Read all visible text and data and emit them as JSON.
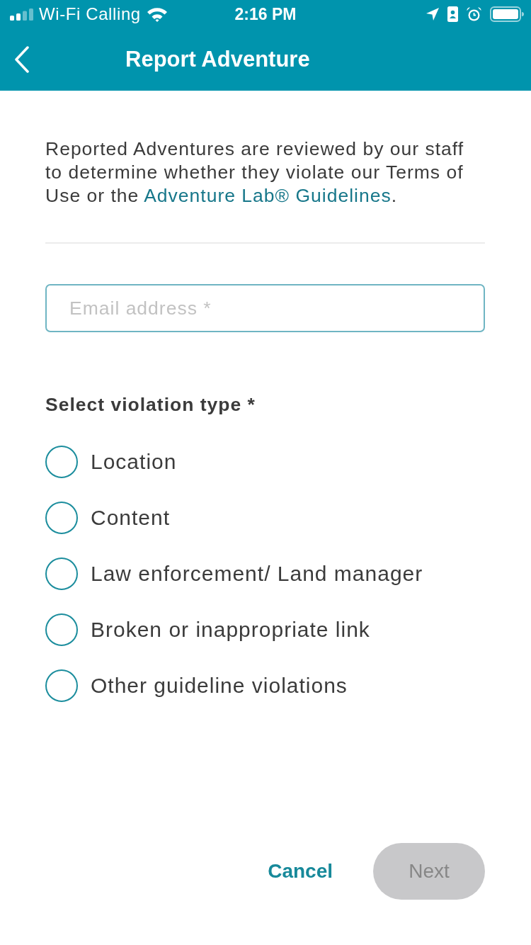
{
  "status_bar": {
    "carrier": "Wi-Fi Calling",
    "time": "2:16 PM"
  },
  "nav_bar": {
    "title": "Report Adventure"
  },
  "intro": {
    "text_before": "Reported Adventures are reviewed by our staff to determine whether they violate our Terms of Use or the ",
    "link": "Adventure Lab® Guidelines",
    "text_after": "."
  },
  "email_field": {
    "placeholder": "Email address *"
  },
  "violation": {
    "label": "Select violation type *",
    "options": [
      {
        "label": "Location",
        "selected": false
      },
      {
        "label": "Content",
        "selected": false
      },
      {
        "label": "Law enforcement/ Land manager",
        "selected": false
      },
      {
        "label": "Broken or inappropriate link",
        "selected": false
      },
      {
        "label": "Other guideline violations",
        "selected": false
      }
    ]
  },
  "buttons": [
    {
      "label": "Cancel",
      "kind": "text",
      "disabled": false
    },
    {
      "label": "Next",
      "kind": "filled",
      "disabled": true
    }
  ]
}
